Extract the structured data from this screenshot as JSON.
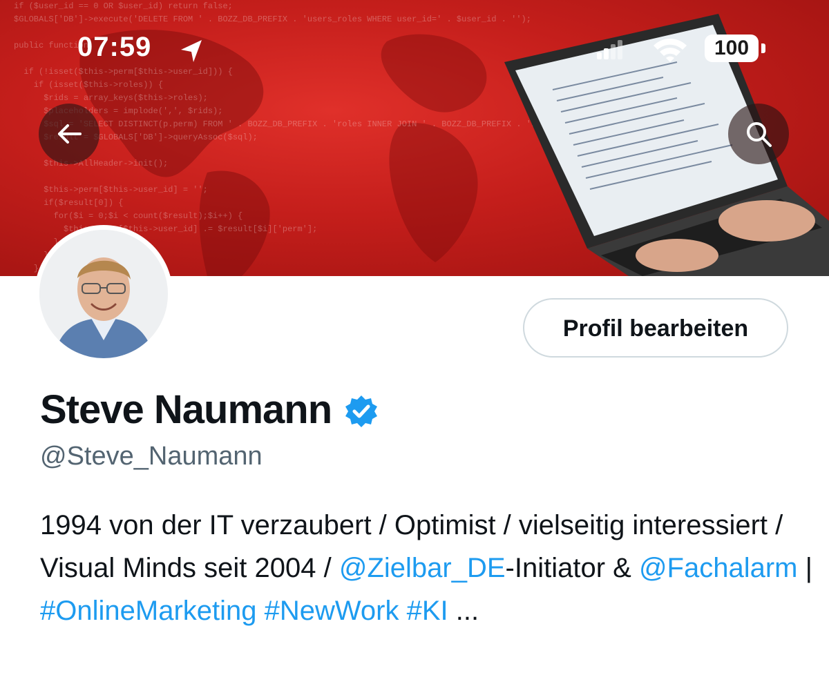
{
  "status_bar": {
    "time": "07:59",
    "battery": "100",
    "icons": [
      "location-arrow-icon",
      "cellular-signal-icon",
      "wifi-icon",
      "battery-icon"
    ]
  },
  "banner": {
    "code_lines": [
      "if ($user_id == 0 OR $user_id) return false;",
      "$GLOBALS['DB']->execute('DELETE FROM ' . BOZZ_DB_PREFIX . 'users_roles WHERE user_id=' . $user_id . '');",
      "",
      "public function",
      "",
      "  if (!isset($this->perm[$this->user_id])) {",
      "    if (isset($this->roles)) {",
      "      $rids = array_keys($this->roles);",
      "      $placeholders = implode(',', $rids);",
      "      $sql = 'SELECT DISTINCT(p.perm) FROM ' . BOZZ_DB_PREFIX . 'roles INNER JOIN ' . BOZZ_DB_PREFIX . 'roles_permission'",
      "      $result = $GLOBALS['DB']->queryAssoc($sql);",
      "",
      "      $this->AllHeader->init();",
      "",
      "      $this->perm[$this->user_id] = '';",
      "      if($result[0]) {",
      "        for($i = 0;$i < count($result);$i++) {",
      "          $this->perm[$this->user_id] .= $result[$i]['perm'];",
      "        }",
      "      }",
      "    }",
      "  }"
    ]
  },
  "nav": {
    "back_icon": "arrow-left-icon",
    "search_icon": "search-icon"
  },
  "profile": {
    "edit_button": "Profil bearbeiten",
    "name": "Steve Naumann",
    "verified_icon": "verified-badge-icon",
    "handle": "@Steve_Naumann"
  },
  "bio": {
    "part1": "1994 von der IT verzaubert / Optimist / vielseitig interessiert / Visual Minds seit 2004 / ",
    "mention1": "@Zielbar_DE",
    "part2": "-Initiator & ",
    "mention2": "@Fachalarm",
    "part3": " | ",
    "hashtag1": "#OnlineMarketing",
    "space1": " ",
    "hashtag2": "#NewWork",
    "space2": " ",
    "hashtag3": "#KI",
    "part4": " ..."
  },
  "colors": {
    "banner_red": "#c41e1b",
    "link_blue": "#1d9bf0",
    "text_dark": "#0f1419",
    "text_muted": "#536471",
    "verified_blue": "#1d9bf0"
  }
}
